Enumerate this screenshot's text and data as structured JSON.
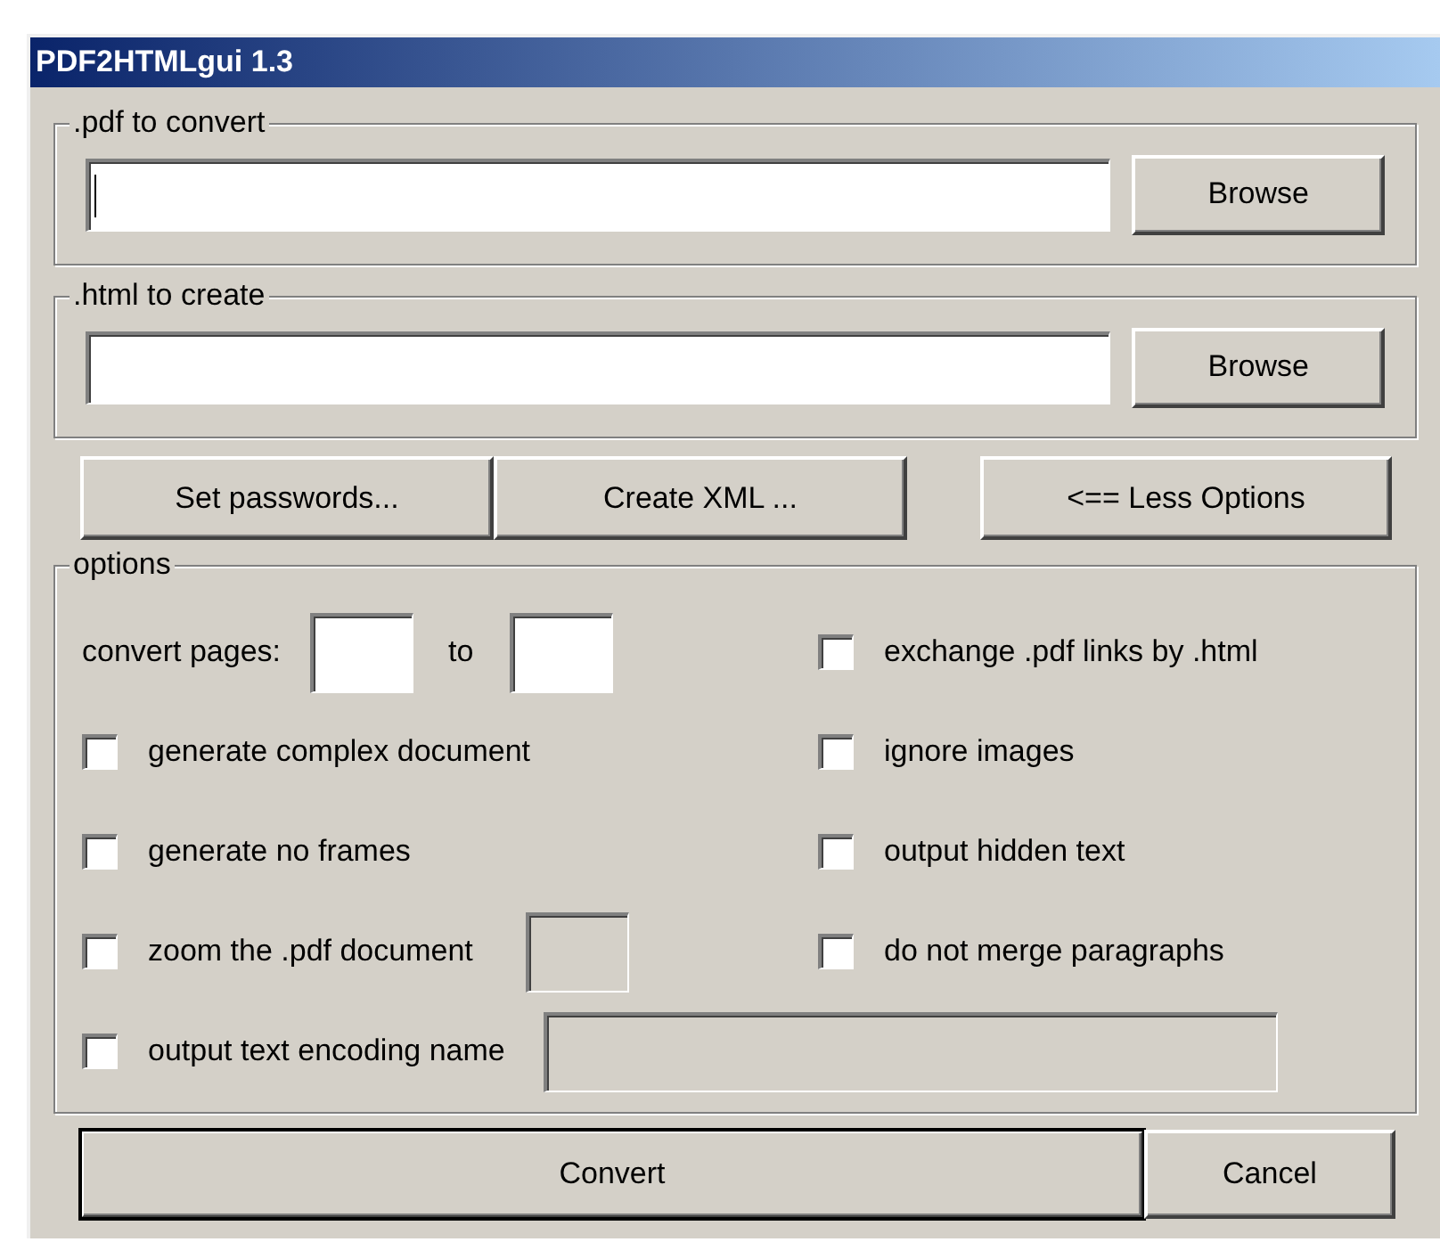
{
  "window": {
    "title": "PDF2HTMLgui 1.3"
  },
  "pdf_group": {
    "legend": ".pdf to convert",
    "field": {
      "focused": true
    },
    "button": "Browse"
  },
  "html_group": {
    "legend": ".html to create",
    "field": {
      "focused": false
    },
    "button": "Browse"
  },
  "action_buttons": [
    "Set passwords...",
    "Create XML ..."
  ],
  "options_toggle": "<== Less Options",
  "options": {
    "legend": "options",
    "left_column": [
      {
        "kind": "range",
        "label": "convert pages:",
        "to_label": "to"
      },
      {
        "kind": "checkbox",
        "label": "generate complex document",
        "checked": false
      },
      {
        "kind": "checkbox",
        "label": "generate no frames",
        "checked": false
      },
      {
        "kind": "checkbox_field",
        "label": "zoom the .pdf document",
        "checked": false,
        "field_disabled": true
      }
    ],
    "right_column": [
      {
        "kind": "checkbox",
        "label": "exchange .pdf links by .html",
        "checked": false
      },
      {
        "kind": "checkbox",
        "label": "ignore images",
        "checked": false
      },
      {
        "kind": "checkbox",
        "label": "output hidden text",
        "checked": false
      },
      {
        "kind": "checkbox",
        "label": "do not merge paragraphs",
        "checked": false
      }
    ],
    "encoding": {
      "label": "output text encoding name",
      "checked": false,
      "field_disabled": true
    }
  },
  "bottom_buttons": [
    {
      "label": "Convert",
      "default": true
    },
    {
      "label": "Cancel",
      "default": false
    }
  ]
}
